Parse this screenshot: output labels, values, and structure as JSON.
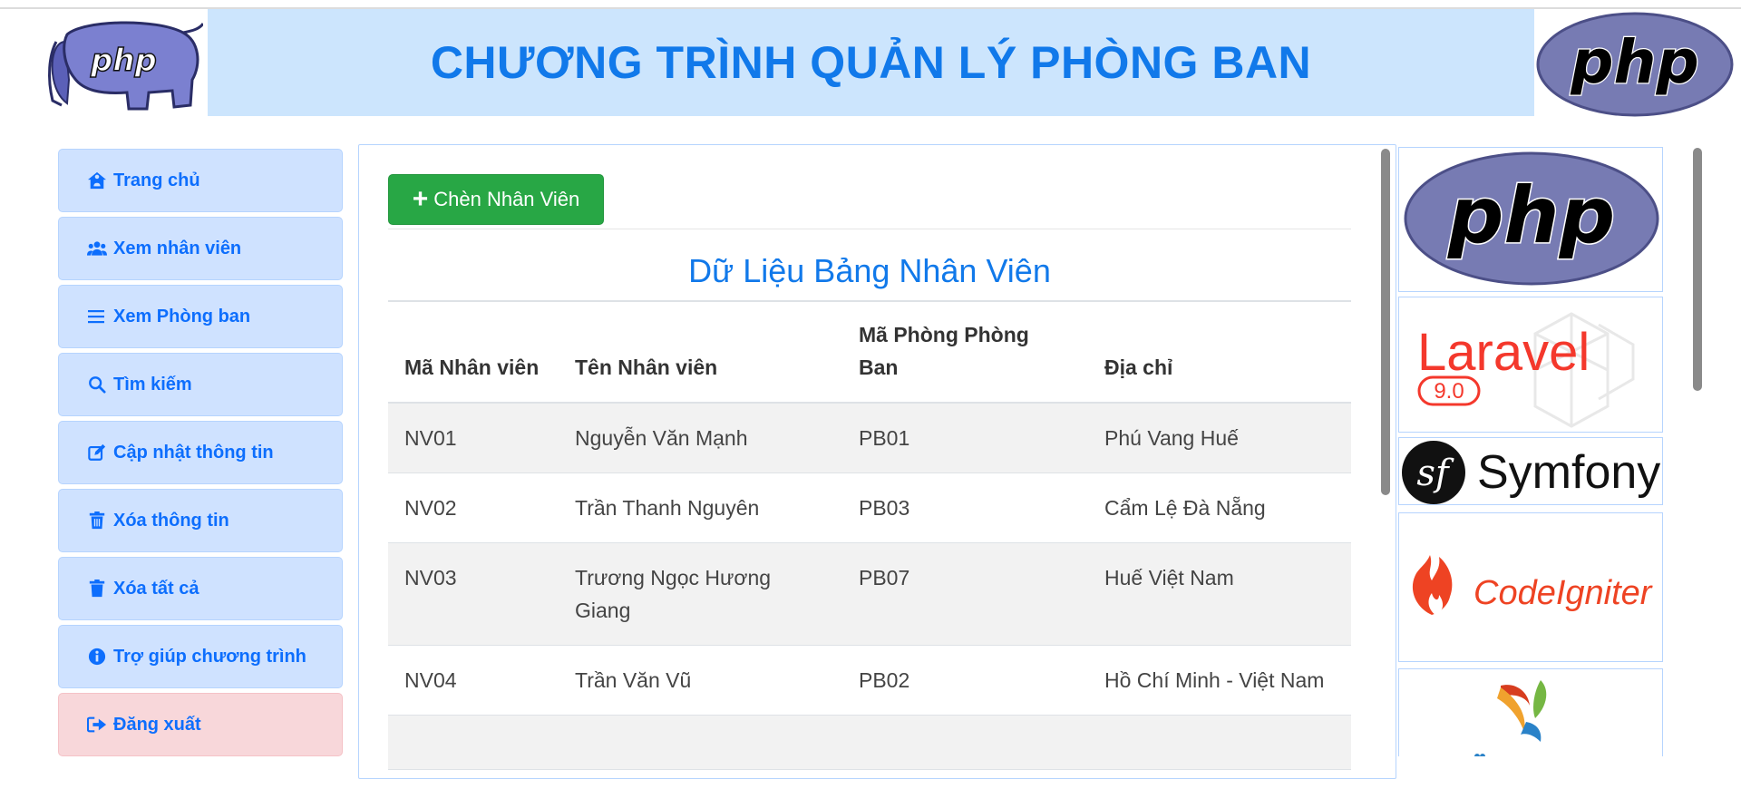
{
  "header": {
    "title": "CHƯƠNG TRÌNH QUẢN LÝ PHÒNG BAN",
    "logo_left_text": "php",
    "logo_right_text": "php"
  },
  "sidebar": {
    "items": [
      {
        "label": "Trang chủ",
        "icon": "home-icon"
      },
      {
        "label": "Xem nhân viên",
        "icon": "users-icon"
      },
      {
        "label": "Xem Phòng ban",
        "icon": "list-icon"
      },
      {
        "label": "Tìm kiếm",
        "icon": "search-icon"
      },
      {
        "label": "Cập nhật thông tin",
        "icon": "edit-icon"
      },
      {
        "label": "Xóa thông tin",
        "icon": "trash-icon"
      },
      {
        "label": "Xóa tất cả",
        "icon": "trash-full-icon"
      },
      {
        "label": "Trợ giúp chương trình",
        "icon": "info-icon"
      },
      {
        "label": "Đăng xuất",
        "icon": "logout-icon"
      }
    ]
  },
  "main": {
    "add_button_label": "Chèn Nhân Viên",
    "table_title": "Dữ Liệu Bảng Nhân Viên",
    "columns": [
      "Mã Nhân viên",
      "Tên Nhân viên",
      "Mã Phòng Phòng Ban",
      "Địa chỉ"
    ],
    "rows": [
      [
        "NV01",
        "Nguyễn Văn Mạnh",
        "PB01",
        "Phú Vang Huế"
      ],
      [
        "NV02",
        "Trần Thanh Nguyên",
        "PB03",
        "Cẩm Lệ Đà Nẵng"
      ],
      [
        "NV03",
        "Trương Ngọc Hương Giang",
        "PB07",
        "Huế Việt Nam"
      ],
      [
        "NV04",
        "Trần Văn Vũ",
        "PB02",
        "Hồ Chí Minh - Việt Nam"
      ]
    ]
  },
  "frameworks": {
    "php": "php",
    "laravel": "Laravel",
    "laravel_version": "9.0",
    "symfony": "Symfony",
    "symfony_mark": "sf",
    "codeigniter": "CodeIgniter"
  },
  "colors": {
    "accent": "#1179ea",
    "nav_bg": "#cfe2ff",
    "logout_bg": "#f8d7da",
    "add_button": "#28a745",
    "banner_bg": "#cce5fd"
  }
}
